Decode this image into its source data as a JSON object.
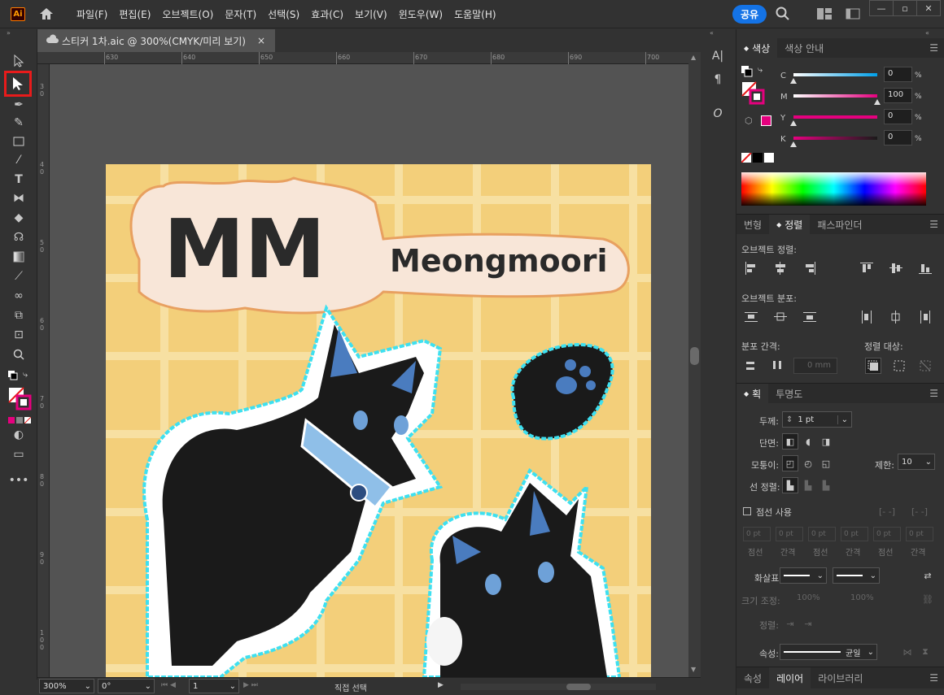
{
  "app": {
    "logo": "Ai",
    "share_label": "공유"
  },
  "menu": [
    "파일(F)",
    "편집(E)",
    "오브젝트(O)",
    "문자(T)",
    "선택(S)",
    "효과(C)",
    "보기(V)",
    "윈도우(W)",
    "도움말(H)"
  ],
  "document": {
    "tab_title": "스티커 1차.aic @ 300%(CMYK/미리 보기)",
    "close": "×"
  },
  "ruler": {
    "h_ticks": [
      "630",
      "640",
      "650",
      "660",
      "670",
      "680",
      "690",
      "700"
    ],
    "v_ticks": [
      "30",
      "40",
      "50",
      "60",
      "70",
      "80",
      "90",
      "100"
    ]
  },
  "artwork": {
    "logo_text": "MM",
    "brand_text": "Meongmoori"
  },
  "status": {
    "zoom": "300%",
    "rotation": "0°",
    "artboard": "1",
    "tool_name": "직접 선택"
  },
  "color_panel": {
    "tabs": [
      "색상",
      "색상 안내"
    ],
    "channels": [
      {
        "name": "C",
        "value": "0",
        "unit": "%"
      },
      {
        "name": "M",
        "value": "100",
        "unit": "%"
      },
      {
        "name": "Y",
        "value": "0",
        "unit": "%"
      },
      {
        "name": "K",
        "value": "0",
        "unit": "%"
      }
    ]
  },
  "align_panel": {
    "tabs": [
      "변형",
      "정렬",
      "패스파인더"
    ],
    "align_objects": "오브젝트 정렬:",
    "distribute_objects": "오브젝트 분포:",
    "distribute_spacing": "분포 간격:",
    "align_to": "정렬 대상:",
    "spacing_value": "0 mm"
  },
  "stroke_panel": {
    "tabs": [
      "획",
      "투명도"
    ],
    "weight_label": "두께:",
    "weight_value": "1 pt",
    "cap_label": "단면:",
    "corner_label": "모퉁이:",
    "limit_label": "제한:",
    "limit_value": "10",
    "align_label": "선 정렬:",
    "dashed_label": "점선 사용",
    "dash_values": [
      "0 pt",
      "0 pt",
      "0 pt",
      "0 pt",
      "0 pt",
      "0 pt"
    ],
    "dash_labels": [
      "점선",
      "간격",
      "점선",
      "간격",
      "점선",
      "간격"
    ],
    "arrow_label": "화살표:",
    "scale_label": "크기 조정:",
    "scale_values": [
      "100%",
      "100%"
    ],
    "align_arrow_label": "정렬:",
    "profile_label": "속성:",
    "profile_value": "균일"
  },
  "bottom_tabs": [
    "속성",
    "레이어",
    "라이브러리"
  ],
  "colors": {
    "accent": "#1473e6",
    "magenta": "#e5007e",
    "artboard_bg": "#f3cf7a",
    "selection": "#e81b1b"
  }
}
